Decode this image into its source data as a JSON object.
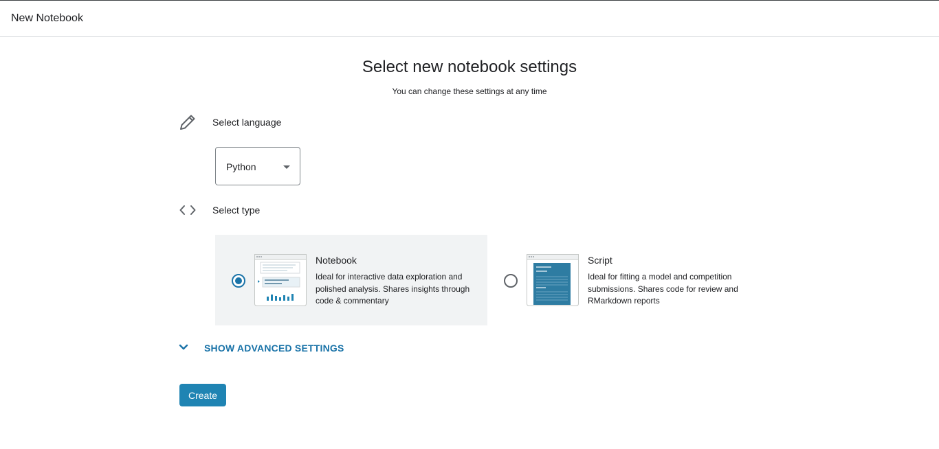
{
  "header": {
    "title": "New Notebook"
  },
  "main": {
    "title": "Select new notebook settings",
    "subtitle": "You can change these settings at any time"
  },
  "language": {
    "label": "Select language",
    "icon": "pencil-icon",
    "selected": "Python"
  },
  "type": {
    "label": "Select type",
    "icon": "code-brackets-icon",
    "options": [
      {
        "title": "Notebook",
        "description": "Ideal for interactive data exploration and polished analysis. Shares insights through code & commentary",
        "selected": true
      },
      {
        "title": "Script",
        "description": "Ideal for fitting a model and competition submissions. Shares code for review and RMarkdown reports",
        "selected": false
      }
    ]
  },
  "advanced": {
    "label": "SHOW ADVANCED SETTINGS",
    "icon": "chevron-down-icon"
  },
  "create": {
    "label": "Create"
  },
  "colors": {
    "accent": "#1f84b3",
    "link": "#1a73a8",
    "card_bg": "#f1f3f4"
  }
}
